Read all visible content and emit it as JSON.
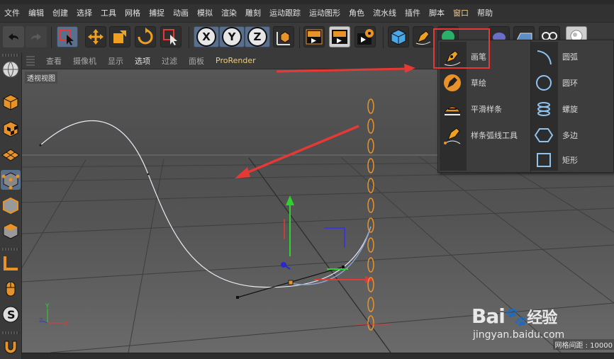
{
  "menu": {
    "items": [
      "文件",
      "编辑",
      "创建",
      "选择",
      "工具",
      "网格",
      "捕捉",
      "动画",
      "模拟",
      "渲染",
      "雕刻",
      "运动跟踪",
      "运动图形",
      "角色",
      "流水线",
      "插件",
      "脚本",
      "窗口",
      "帮助"
    ],
    "accent_index": 17
  },
  "viewport": {
    "header_items": [
      "查看",
      "摄像机",
      "显示",
      "选项",
      "过滤",
      "面板",
      "ProRender"
    ],
    "active_index": 3,
    "label": "透视视图",
    "grid_readout": "网格间距 : 10000"
  },
  "popup": {
    "left_items": [
      "画笔",
      "草绘",
      "平滑样条",
      "样条弧线工具"
    ],
    "right_items": [
      "圆弧",
      "圆环",
      "螺旋",
      "多边",
      "矩形"
    ]
  },
  "watermark": {
    "brand": "Bai",
    "brand_suffix": "经验",
    "url": "jingyan.baidu.com"
  },
  "colors": {
    "highlight": "#e53935",
    "accent_orange": "#e8932a"
  }
}
